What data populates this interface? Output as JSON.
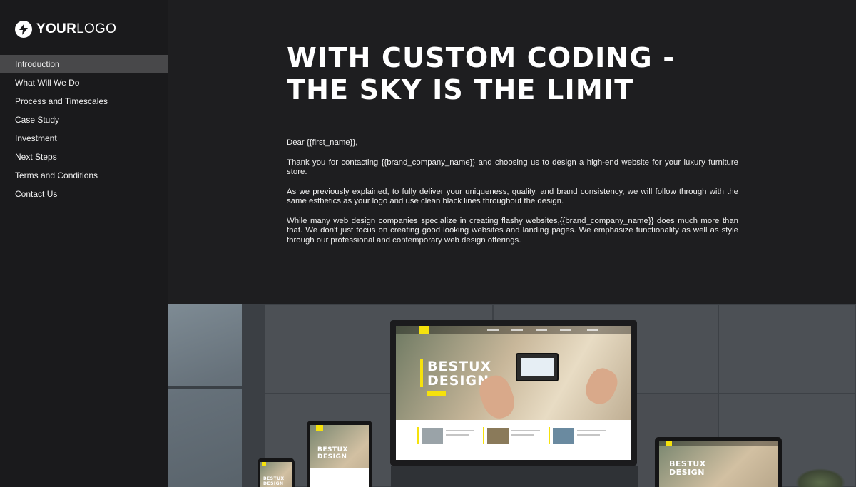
{
  "logo": {
    "icon": "lightning-bolt-icon",
    "text_bold": "YOUR",
    "text_light": "LOGO"
  },
  "sidebar": {
    "items": [
      {
        "label": "Introduction",
        "active": true
      },
      {
        "label": "What Will We Do",
        "active": false
      },
      {
        "label": "Process and Timescales",
        "active": false
      },
      {
        "label": "Case Study",
        "active": false
      },
      {
        "label": "Investment",
        "active": false
      },
      {
        "label": "Next Steps",
        "active": false
      },
      {
        "label": "Terms and Conditions",
        "active": false
      },
      {
        "label": "Contact Us",
        "active": false
      }
    ]
  },
  "main": {
    "headline_line1": "WITH CUSTOM CODING -",
    "headline_line2": "THE SKY IS THE LIMIT",
    "greeting": "Dear {{first_name}},",
    "paragraphs": [
      "Thank you for contacting {{brand_company_name}} and choosing us to design a high-end website for your luxury furniture store.",
      "As we previously explained, to fully deliver your uniqueness, quality, and brand consistency, we will follow through with the same esthetics as your logo and use clean black lines throughout the design.",
      "While many web design companies specialize in creating flashy websites,{{brand_company_name}} does much more than that. We don't just focus on creating good looking websites and landing pages. We emphasize functionality as well as style through our professional and contemporary web design offerings."
    ]
  },
  "hero": {
    "screen_title_line1": "BESTUX",
    "screen_title_line2": "DESIGN"
  },
  "colors": {
    "sidebar_bg": "#1a1a1c",
    "active_item_bg": "#48484a",
    "main_bg": "#1e1e20",
    "accent_yellow": "#f5e20c"
  }
}
